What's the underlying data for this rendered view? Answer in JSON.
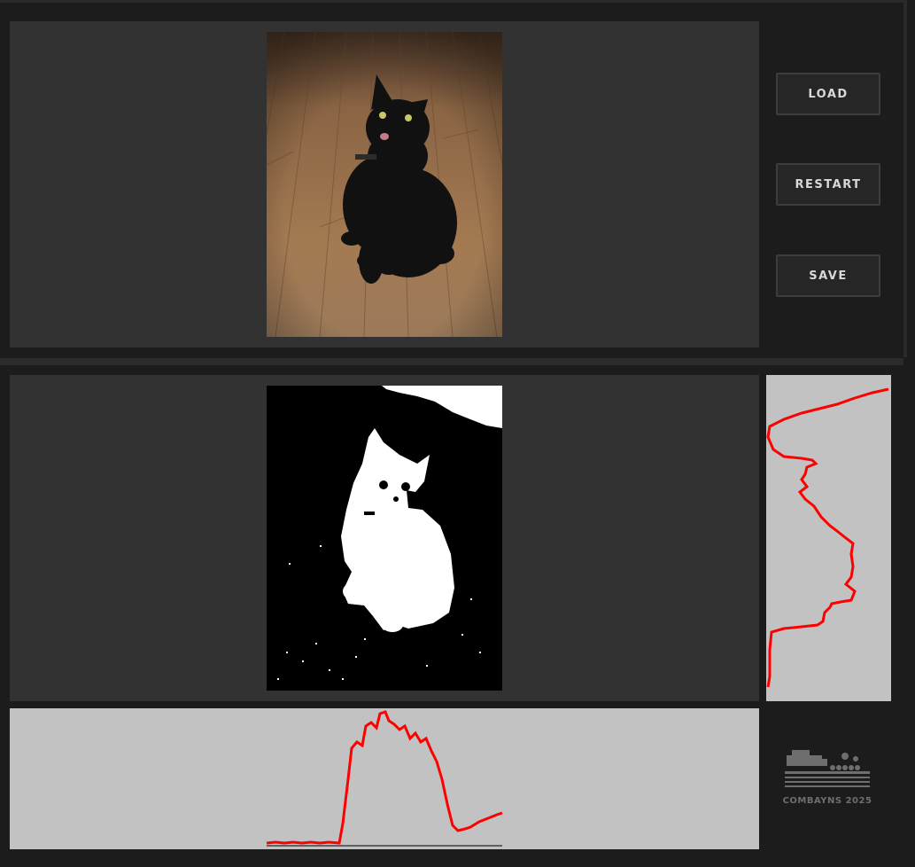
{
  "toolbar": {
    "load_label": "LOAD",
    "restart_label": "RESTART",
    "save_label": "SAVE"
  },
  "logo": {
    "text": "COMBAYNS 2025"
  },
  "colors": {
    "background": "#1c1c1c",
    "panel": "#323232",
    "histogram_bg": "#c2c2c2",
    "histogram_line": "#ff0000"
  }
}
